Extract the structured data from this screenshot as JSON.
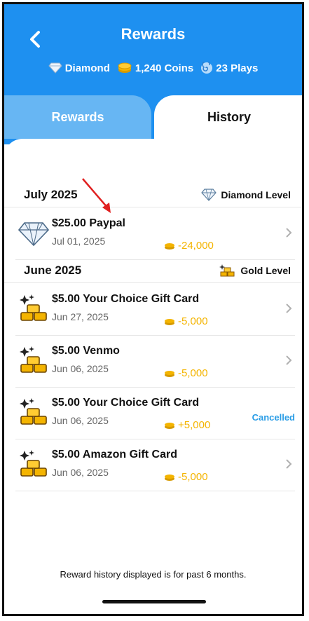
{
  "header": {
    "title": "Rewards",
    "back_icon": "back-arrow-icon",
    "stats": [
      {
        "icon": "diamond-icon",
        "label": "Diamond"
      },
      {
        "icon": "coin-stack-icon",
        "label": "1,240 Coins"
      },
      {
        "icon": "spiral-icon",
        "label": "23 Plays"
      }
    ]
  },
  "tabs": [
    {
      "label": "Rewards",
      "active": false
    },
    {
      "label": "History",
      "active": true
    }
  ],
  "sections": [
    {
      "title": "July 2025",
      "level_label": "Diamond Level",
      "level_icon": "diamond-icon",
      "items": [
        {
          "icon": "diamond-icon",
          "name": "$25.00 Paypal",
          "date": "Jul 01, 2025",
          "amount": "-24,000",
          "status": ""
        }
      ]
    },
    {
      "title": "June 2025",
      "level_label": "Gold Level",
      "level_icon": "gold-bars-icon",
      "items": [
        {
          "icon": "gold-bars-icon",
          "name": "$5.00 Your Choice Gift Card",
          "date": "Jun 27, 2025",
          "amount": "-5,000",
          "status": ""
        },
        {
          "icon": "gold-bars-icon",
          "name": "$5.00 Venmo",
          "date": "Jun 06, 2025",
          "amount": "-5,000",
          "status": ""
        },
        {
          "icon": "gold-bars-icon",
          "name": "$5.00 Your Choice Gift Card",
          "date": "Jun 06, 2025",
          "amount": "+5,000",
          "status": "Cancelled"
        },
        {
          "icon": "gold-bars-icon",
          "name": "$5.00 Amazon Gift Card",
          "date": "Jun 06, 2025",
          "amount": "-5,000",
          "status": ""
        }
      ]
    }
  ],
  "footer_note": "Reward history displayed is for past 6 months.",
  "colors": {
    "header_blue": "#1e90f0",
    "inactive_tab": "#67b6f3",
    "coin_gold": "#f4b400",
    "cancelled_blue": "#2a9de6",
    "annotation_red": "#e02020"
  }
}
